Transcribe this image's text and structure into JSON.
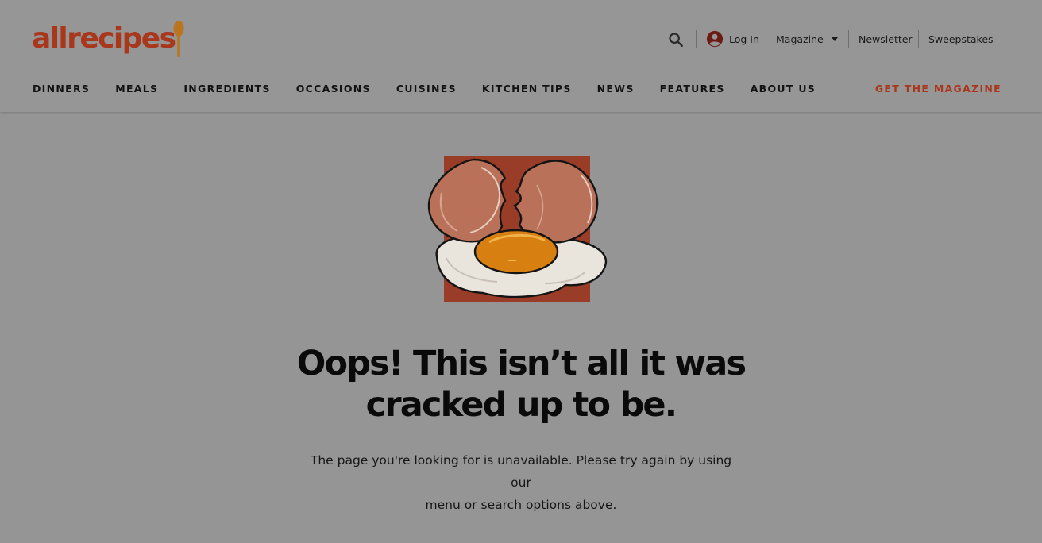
{
  "brand": {
    "name": "allrecipes",
    "accent": "#a9371c",
    "spoon_color": "#b9761f"
  },
  "utility": {
    "search_icon": "search-icon",
    "login_icon": "account-circle-icon",
    "login_label": "Log In",
    "magazine_label": "Magazine",
    "newsletter_label": "Newsletter",
    "sweepstakes_label": "Sweepstakes"
  },
  "nav": {
    "items": [
      "DINNERS",
      "MEALS",
      "INGREDIENTS",
      "OCCASIONS",
      "CUISINES",
      "KITCHEN TIPS",
      "NEWS",
      "FEATURES",
      "ABOUT US"
    ],
    "cta_label": "GET THE MAGAZINE"
  },
  "error": {
    "illustration": "cracked-egg-illustration",
    "headline_line1": "Oops! This isn’t all it was",
    "headline_line2": "cracked up to be.",
    "message_line1": "The page you're looking for is unavailable. Please try again by using our",
    "message_line2": "menu or search options above."
  },
  "colors": {
    "overlay_bg": "#959595",
    "illustration_bg": "#9a3d28",
    "yolk": "#d77f10"
  }
}
